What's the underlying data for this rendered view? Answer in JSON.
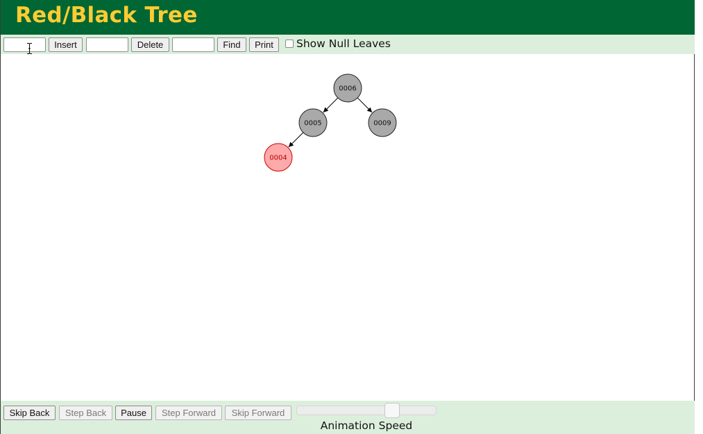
{
  "app": {
    "title": "Red/Black Tree"
  },
  "toolbar": {
    "insert_input_value": "",
    "insert_label": "Insert",
    "delete_input_value": "",
    "delete_label": "Delete",
    "find_input_value": "",
    "find_label": "Find",
    "print_label": "Print",
    "show_null_leaves_label": "Show Null Leaves",
    "show_null_leaves_checked": false
  },
  "tree": {
    "nodes": [
      {
        "id": "n6",
        "label": "0006",
        "color": "black"
      },
      {
        "id": "n5",
        "label": "0005",
        "color": "black"
      },
      {
        "id": "n9",
        "label": "0009",
        "color": "black"
      },
      {
        "id": "n4",
        "label": "0004",
        "color": "red"
      }
    ],
    "edges": [
      {
        "from": "n6",
        "to": "n5"
      },
      {
        "from": "n6",
        "to": "n9"
      },
      {
        "from": "n5",
        "to": "n4"
      }
    ]
  },
  "animation": {
    "skip_back_label": "Skip Back",
    "step_back_label": "Step Back",
    "pause_label": "Pause",
    "step_forward_label": "Step Forward",
    "skip_forward_label": "Skip Forward",
    "speed_label": "Animation Speed",
    "speed_value": 0.7
  },
  "colors": {
    "header_bg": "#006633",
    "title": "#ffcc33",
    "toolbar_bg": "#dcefdc",
    "black_node_fill": "#a9a9a9",
    "black_node_stroke": "#222222",
    "red_node_fill": "#ffaaaa",
    "red_node_stroke": "#cc0000",
    "red_node_text": "#bb0000"
  },
  "icons": {
    "cursor": "text-cursor-icon"
  }
}
